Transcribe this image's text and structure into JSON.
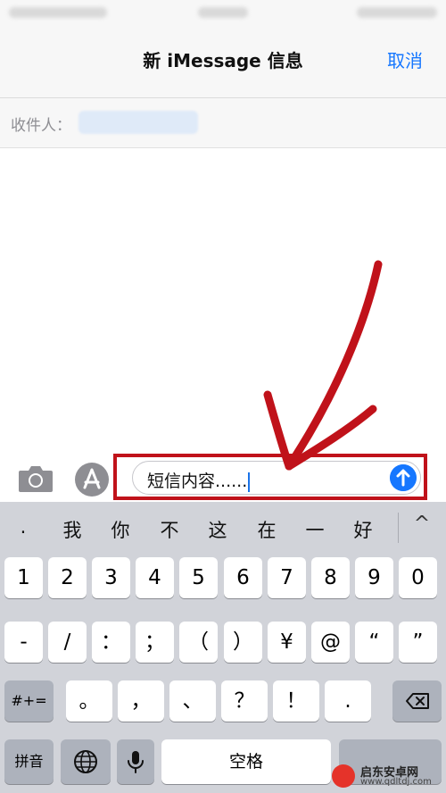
{
  "nav": {
    "title": "新 iMessage 信息",
    "cancel_label": "取消"
  },
  "recipient": {
    "label": "收件人："
  },
  "compose": {
    "text": "短信内容......"
  },
  "keyboard": {
    "candidates": [
      ".",
      "我",
      "你",
      "不",
      "这",
      "在",
      "一",
      "好"
    ],
    "chevron": "^",
    "row1": [
      "1",
      "2",
      "3",
      "4",
      "5",
      "6",
      "7",
      "8",
      "9",
      "0"
    ],
    "row2": [
      "-",
      "/",
      "：",
      "；",
      "（",
      "）",
      "¥",
      "@",
      "“",
      "”"
    ],
    "row3_left": "#+=",
    "row3": [
      "。",
      "，",
      "、",
      "？",
      "！",
      "."
    ],
    "bottom_left": "拼音",
    "space": "空格"
  },
  "watermark": {
    "line1": "启东安卓网",
    "line2": "www.qdltdj.com"
  },
  "colors": {
    "accent": "#1677ff",
    "annotation": "#c0121a"
  }
}
